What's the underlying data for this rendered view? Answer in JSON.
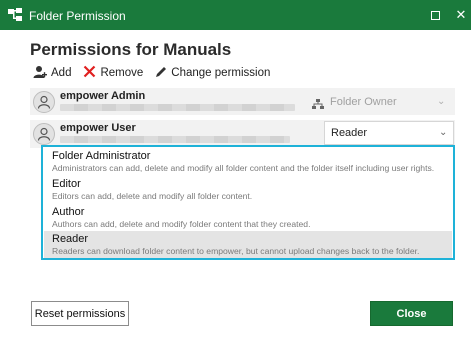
{
  "window": {
    "title": "Folder Permission",
    "app_icon": "tree-icon",
    "controls": {
      "maximize": "maximize-icon",
      "close": "close-icon",
      "close_glyph": "✕"
    }
  },
  "heading": "Permissions for Manuals",
  "toolbar": {
    "add_label": "Add",
    "remove_label": "Remove",
    "change_label": "Change permission"
  },
  "users": [
    {
      "name": "empower Admin",
      "role": "Folder Owner"
    },
    {
      "name": "empower User",
      "role": "Reader"
    }
  ],
  "options": [
    {
      "title": "Folder Administrator",
      "desc": "Administrators can add, delete and modify all folder content and the folder itself including user rights."
    },
    {
      "title": "Editor",
      "desc": "Editors can add, delete and modify all folder content."
    },
    {
      "title": "Author",
      "desc": "Authors can add, delete and modify folder content that they created."
    },
    {
      "title": "Reader",
      "desc": "Readers can download folder content to empower, but cannot upload changes back to the folder."
    }
  ],
  "buttons": {
    "reset_label": "Reset permissions",
    "close_label": "Close"
  },
  "colors": {
    "titlebar": "#1a7a3c",
    "accent": "#1eb2d8",
    "close_button": "#1a7a3c"
  }
}
